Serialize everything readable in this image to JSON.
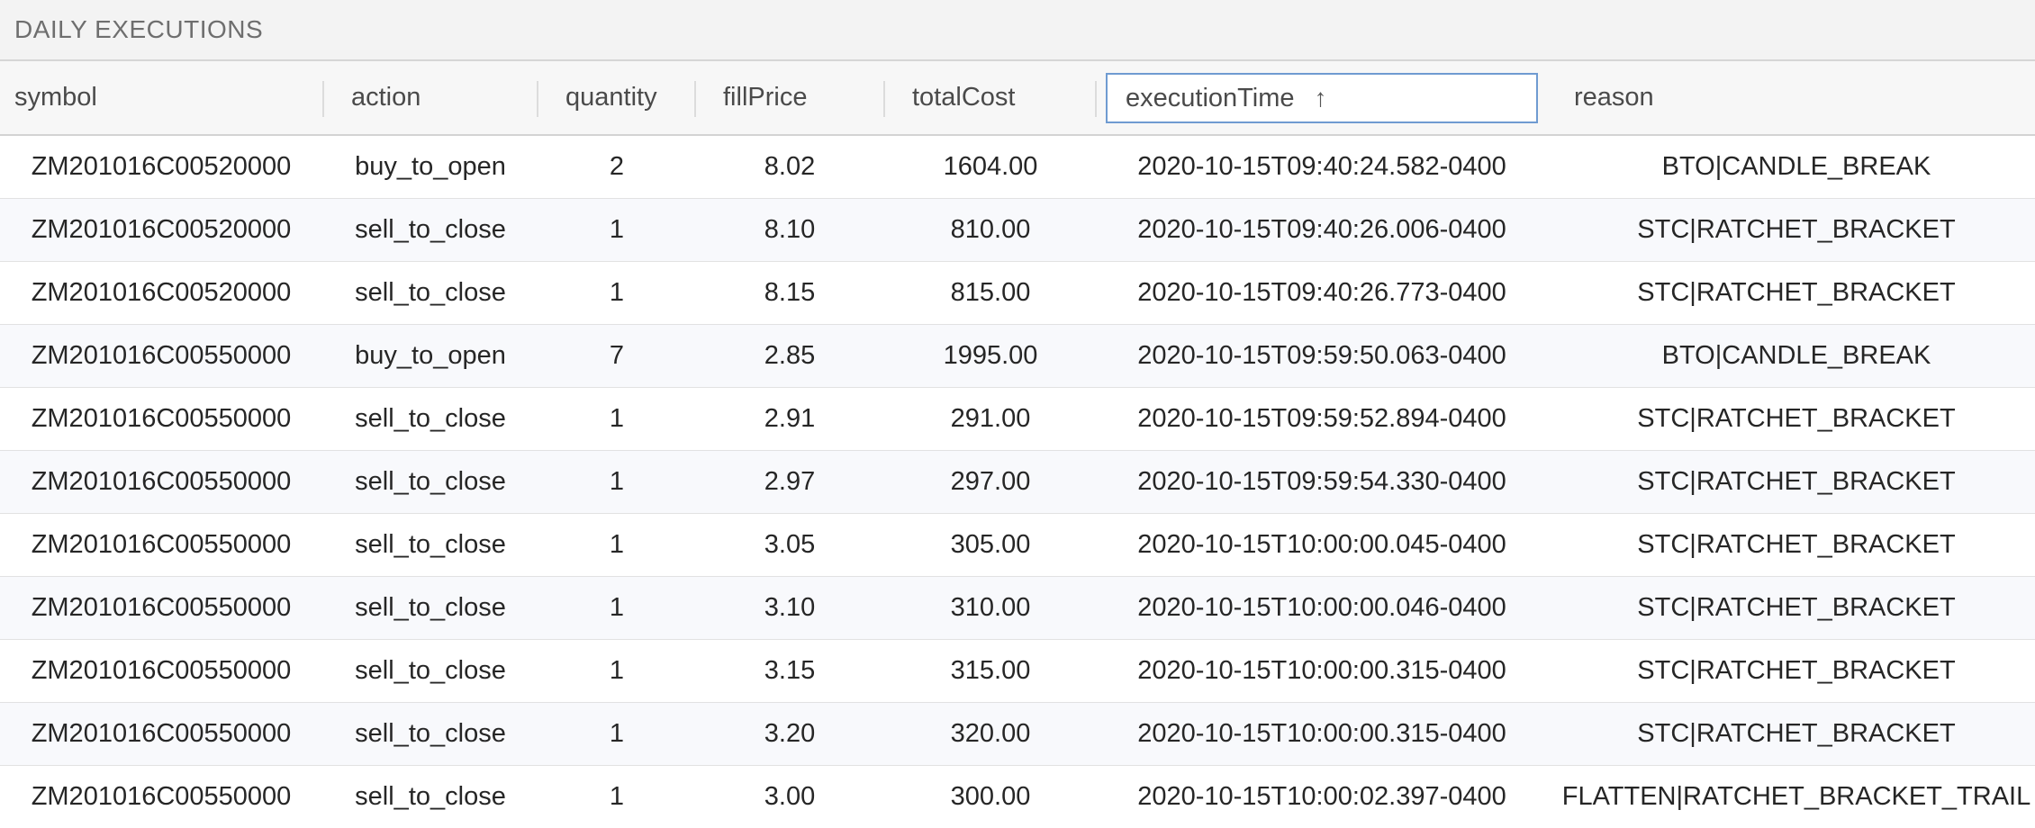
{
  "panel": {
    "title": "DAILY EXECUTIONS"
  },
  "columns": [
    {
      "key": "symbol",
      "label": "symbol"
    },
    {
      "key": "action",
      "label": "action"
    },
    {
      "key": "quantity",
      "label": "quantity"
    },
    {
      "key": "fillPrice",
      "label": "fillPrice"
    },
    {
      "key": "totalCost",
      "label": "totalCost"
    },
    {
      "key": "executionTime",
      "label": "executionTime",
      "sort_indicator": "↑",
      "sort_direction": "ascending"
    },
    {
      "key": "reason",
      "label": "reason"
    }
  ],
  "rows": [
    {
      "symbol": "ZM201016C00520000",
      "action": "buy_to_open",
      "quantity": "2",
      "fillPrice": "8.02",
      "totalCost": "1604.00",
      "executionTime": "2020-10-15T09:40:24.582-0400",
      "reason": "BTO|CANDLE_BREAK"
    },
    {
      "symbol": "ZM201016C00520000",
      "action": "sell_to_close",
      "quantity": "1",
      "fillPrice": "8.10",
      "totalCost": "810.00",
      "executionTime": "2020-10-15T09:40:26.006-0400",
      "reason": "STC|RATCHET_BRACKET"
    },
    {
      "symbol": "ZM201016C00520000",
      "action": "sell_to_close",
      "quantity": "1",
      "fillPrice": "8.15",
      "totalCost": "815.00",
      "executionTime": "2020-10-15T09:40:26.773-0400",
      "reason": "STC|RATCHET_BRACKET"
    },
    {
      "symbol": "ZM201016C00550000",
      "action": "buy_to_open",
      "quantity": "7",
      "fillPrice": "2.85",
      "totalCost": "1995.00",
      "executionTime": "2020-10-15T09:59:50.063-0400",
      "reason": "BTO|CANDLE_BREAK"
    },
    {
      "symbol": "ZM201016C00550000",
      "action": "sell_to_close",
      "quantity": "1",
      "fillPrice": "2.91",
      "totalCost": "291.00",
      "executionTime": "2020-10-15T09:59:52.894-0400",
      "reason": "STC|RATCHET_BRACKET"
    },
    {
      "symbol": "ZM201016C00550000",
      "action": "sell_to_close",
      "quantity": "1",
      "fillPrice": "2.97",
      "totalCost": "297.00",
      "executionTime": "2020-10-15T09:59:54.330-0400",
      "reason": "STC|RATCHET_BRACKET"
    },
    {
      "symbol": "ZM201016C00550000",
      "action": "sell_to_close",
      "quantity": "1",
      "fillPrice": "3.05",
      "totalCost": "305.00",
      "executionTime": "2020-10-15T10:00:00.045-0400",
      "reason": "STC|RATCHET_BRACKET"
    },
    {
      "symbol": "ZM201016C00550000",
      "action": "sell_to_close",
      "quantity": "1",
      "fillPrice": "3.10",
      "totalCost": "310.00",
      "executionTime": "2020-10-15T10:00:00.046-0400",
      "reason": "STC|RATCHET_BRACKET"
    },
    {
      "symbol": "ZM201016C00550000",
      "action": "sell_to_close",
      "quantity": "1",
      "fillPrice": "3.15",
      "totalCost": "315.00",
      "executionTime": "2020-10-15T10:00:00.315-0400",
      "reason": "STC|RATCHET_BRACKET"
    },
    {
      "symbol": "ZM201016C00550000",
      "action": "sell_to_close",
      "quantity": "1",
      "fillPrice": "3.20",
      "totalCost": "320.00",
      "executionTime": "2020-10-15T10:00:00.315-0400",
      "reason": "STC|RATCHET_BRACKET"
    },
    {
      "symbol": "ZM201016C00550000",
      "action": "sell_to_close",
      "quantity": "1",
      "fillPrice": "3.00",
      "totalCost": "300.00",
      "executionTime": "2020-10-15T10:00:02.397-0400",
      "reason": "FLATTEN|RATCHET_BRACKET_TRAIL"
    }
  ]
}
